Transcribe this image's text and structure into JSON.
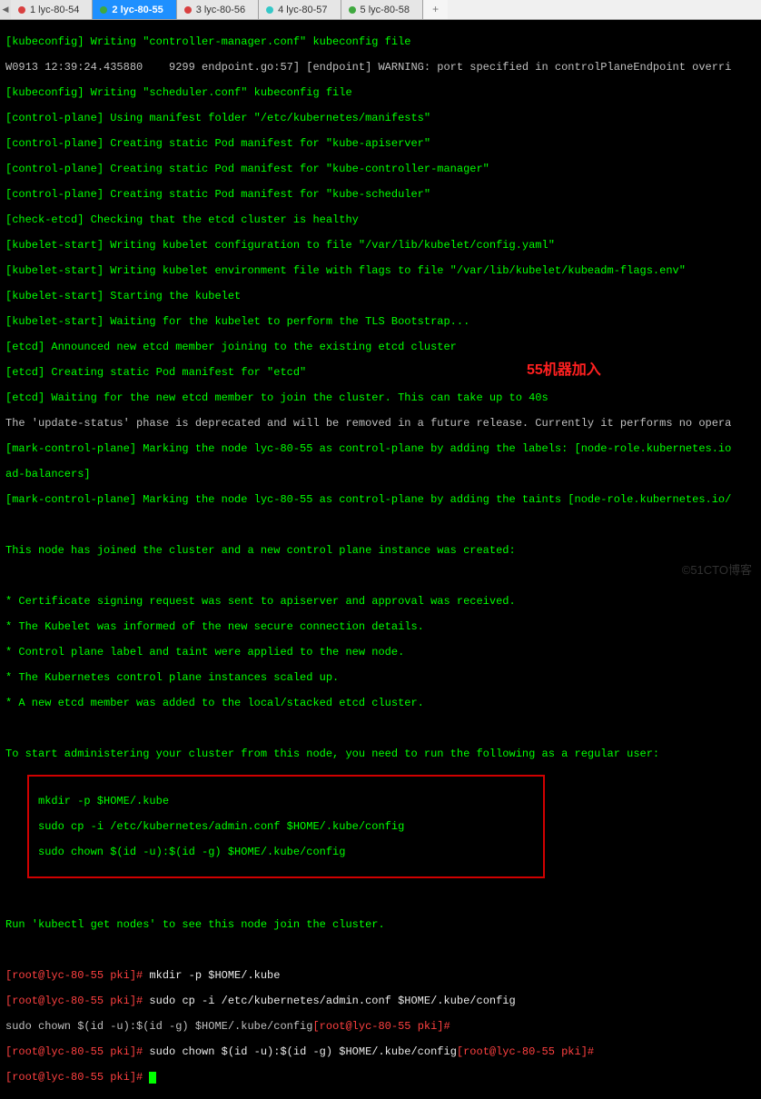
{
  "tabs": [
    {
      "label": "1 lyc-80-54",
      "dot": "red",
      "active": false
    },
    {
      "label": "2 lyc-80-55",
      "dot": "green",
      "active": true
    },
    {
      "label": "3 lyc-80-56",
      "dot": "red",
      "active": false
    },
    {
      "label": "4 lyc-80-57",
      "dot": "cyan",
      "active": false
    },
    {
      "label": "5 lyc-80-58",
      "dot": "green",
      "active": false
    }
  ],
  "tab_plus": "+",
  "arrow": "◀",
  "lines": {
    "l1": "[kubeconfig] Writing \"controller-manager.conf\" kubeconfig file",
    "l2": "W0913 12:39:24.435880    9299 endpoint.go:57] [endpoint] WARNING: port specified in controlPlaneEndpoint overri",
    "l3": "[kubeconfig] Writing \"scheduler.conf\" kubeconfig file",
    "l4": "[control-plane] Using manifest folder \"/etc/kubernetes/manifests\"",
    "l5": "[control-plane] Creating static Pod manifest for \"kube-apiserver\"",
    "l6": "[control-plane] Creating static Pod manifest for \"kube-controller-manager\"",
    "l7": "[control-plane] Creating static Pod manifest for \"kube-scheduler\"",
    "l8": "[check-etcd] Checking that the etcd cluster is healthy",
    "l9": "[kubelet-start] Writing kubelet configuration to file \"/var/lib/kubelet/config.yaml\"",
    "l10": "[kubelet-start] Writing kubelet environment file with flags to file \"/var/lib/kubelet/kubeadm-flags.env\"",
    "l11": "[kubelet-start] Starting the kubelet",
    "l12": "[kubelet-start] Waiting for the kubelet to perform the TLS Bootstrap...",
    "l13": "[etcd] Announced new etcd member joining to the existing etcd cluster",
    "l14": "[etcd] Creating static Pod manifest for \"etcd\"",
    "l15": "[etcd] Waiting for the new etcd member to join the cluster. This can take up to 40s",
    "l16": "The 'update-status' phase is deprecated and will be removed in a future release. Currently it performs no opera",
    "l17": "[mark-control-plane] Marking the node lyc-80-55 as control-plane by adding the labels: [node-role.kubernetes.io",
    "l18": "ad-balancers]",
    "l19": "[mark-control-plane] Marking the node lyc-80-55 as control-plane by adding the taints [node-role.kubernetes.io/",
    "blank": " ",
    "l20": "This node has joined the cluster and a new control plane instance was created:",
    "l21": "* Certificate signing request was sent to apiserver and approval was received.",
    "l22": "* The Kubelet was informed of the new secure connection details.",
    "l23": "* Control plane label and taint were applied to the new node.",
    "l24": "* The Kubernetes control plane instances scaled up.",
    "l25": "* A new etcd member was added to the local/stacked etcd cluster.",
    "l26": "To start administering your cluster from this node, you need to run the following as a regular user:",
    "box1": "mkdir -p $HOME/.kube",
    "box2": "sudo cp -i /etc/kubernetes/admin.conf $HOME/.kube/config",
    "box3": "sudo chown $(id -u):$(id -g) $HOME/.kube/config",
    "l27": "Run 'kubectl get nodes' to see this node join the cluster."
  },
  "prompt_lines": {
    "p1_prompt": "[root@lyc-80-55 pki]#",
    "p1_cmd": " mkdir -p $HOME/.kube",
    "p2_prompt": "[root@lyc-80-55 pki]#",
    "p2_cmd": " sudo cp -i /etc/kubernetes/admin.conf $HOME/.kube/config",
    "p3_plain": "sudo chown $(id -u):$(id -g) $HOME/.kube/config",
    "p3_prompt": "[root@lyc-80-55 pki]#",
    "p4_prompt": "[root@lyc-80-55 pki]#",
    "p4_cmd": " sudo chown $(id -u):$(id -g) $HOME/.kube/config",
    "p4_prompt2": "[root@lyc-80-55 pki]#",
    "p5_prompt": "[root@lyc-80-55 pki]#",
    "p5_cmd": " "
  },
  "annotation": "55机器加入",
  "watermark": "©51CTO博客"
}
